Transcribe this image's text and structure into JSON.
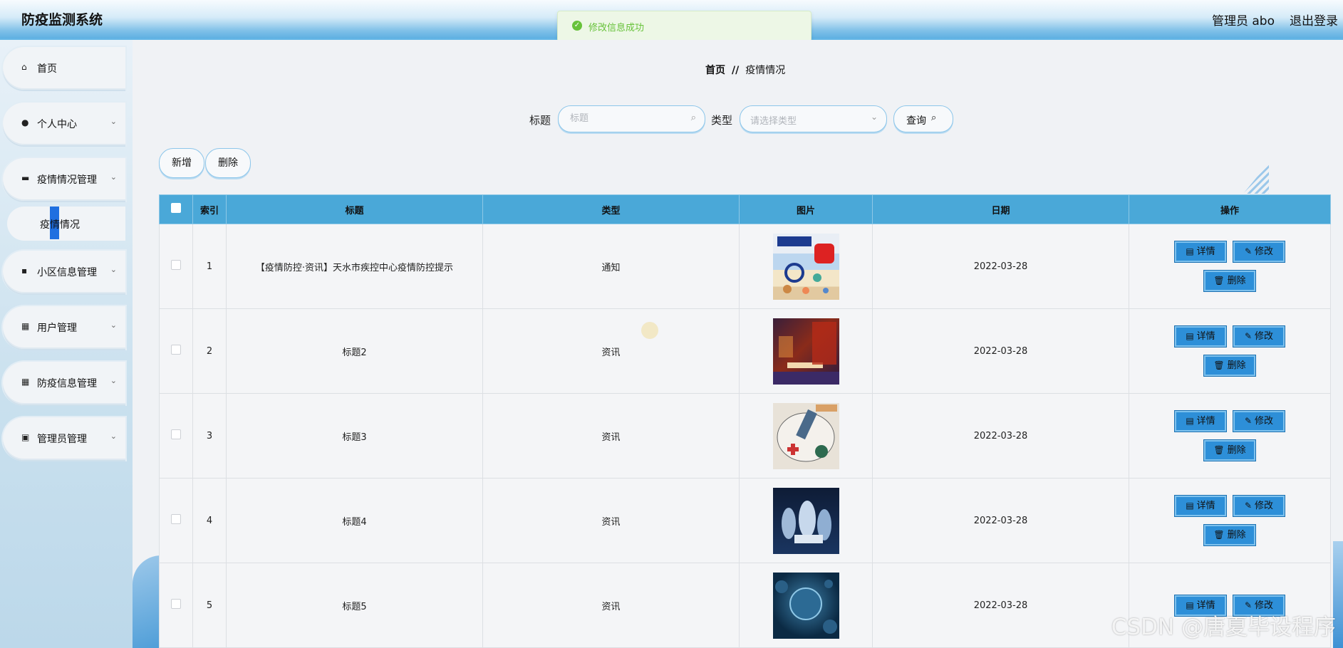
{
  "header": {
    "app_title": "防疫监测系统",
    "admin_label": "管理员 abo",
    "logout_label": "退出登录"
  },
  "toast": {
    "message": "修改信息成功",
    "status": "success",
    "color": "#67c23a"
  },
  "sidebar": {
    "items": [
      {
        "label": "首页",
        "icon": "home-icon"
      },
      {
        "label": "个人中心",
        "icon": "user-icon"
      },
      {
        "label": "疫情情况管理",
        "icon": "briefcase-icon"
      },
      {
        "label": "小区信息管理",
        "icon": "chat-icon"
      },
      {
        "label": "用户管理",
        "icon": "grid-icon"
      },
      {
        "label": "防疫信息管理",
        "icon": "grid-icon"
      },
      {
        "label": "管理员管理",
        "icon": "clipboard-icon"
      }
    ],
    "active_subitem": "疫情情况"
  },
  "breadcrumb": {
    "home": "首页",
    "separator": "//",
    "current": "疫情情况"
  },
  "search": {
    "title_label": "标题",
    "title_placeholder": "标题",
    "type_label": "类型",
    "type_placeholder": "请选择类型",
    "query_button": "查询"
  },
  "toolbar": {
    "add_button": "新增",
    "delete_button": "删除"
  },
  "table": {
    "columns": [
      "索引",
      "标题",
      "类型",
      "图片",
      "日期",
      "操作"
    ],
    "rows": [
      {
        "index": "1",
        "title": "【疫情防控·资讯】天水市疾控中心疫情防控提示",
        "type": "通知",
        "image": "poster-image",
        "date": "2022-03-28"
      },
      {
        "index": "2",
        "title": "标题2",
        "type": "资讯",
        "image": "night-street-image",
        "date": "2022-03-28"
      },
      {
        "index": "3",
        "title": "标题3",
        "type": "资讯",
        "image": "illustration-image",
        "date": "2022-03-28"
      },
      {
        "index": "4",
        "title": "标题4",
        "type": "资讯",
        "image": "medical-staff-image",
        "date": "2022-03-28"
      },
      {
        "index": "5",
        "title": "标题5",
        "type": "资讯",
        "image": "virus-image",
        "date": "2022-03-28"
      }
    ],
    "row_actions": {
      "detail": "详情",
      "edit": "修改",
      "delete": "删除"
    }
  },
  "colors": {
    "header_blue": "#5eb0e2",
    "table_header": "#4aa8d8",
    "action_button": "#2d8fd8",
    "submenu_active": "#1f6fe0"
  },
  "watermark": "CSDN @唐夏毕设程序"
}
